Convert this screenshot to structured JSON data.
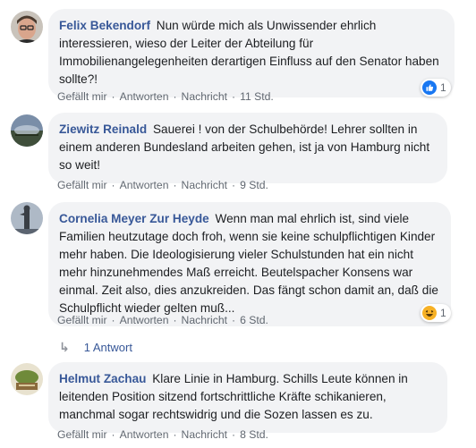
{
  "comments": [
    {
      "author": "Felix Bekendorf",
      "text": "Nun würde mich als Unwissender ehrlich interessieren, wieso der Leiter der Abteilung für Immobilienangelegenheiten derartigen Einfluss auf den Senator haben sollte?!",
      "actions": {
        "like": "Gefällt mir",
        "reply": "Antworten",
        "message": "Nachricht"
      },
      "time": "11 Std.",
      "reaction": {
        "icon": "like-icon",
        "count": "1"
      }
    },
    {
      "author": "Ziewitz Reinald",
      "text": "Sauerei ! von der Schulbehörde! Lehrer sollten in einem anderen Bundesland arbeiten gehen, ist ja von Hamburg nicht so weit!",
      "actions": {
        "like": "Gefällt mir",
        "reply": "Antworten",
        "message": "Nachricht"
      },
      "time": "9 Std."
    },
    {
      "author": "Cornelia Meyer Zur Heyde",
      "text": "Wenn man mal ehrlich ist, sind viele Familien heutzutage doch froh, wenn sie keine schulpflichtigen Kinder mehr haben. Die Ideologisierung vieler Schulstunden hat ein nicht mehr hinzunehmendes Maß erreicht. Beutelspacher Konsens war einmal. Zeit also, dies anzukreiden. Das fängt schon damit an, daß die Schulpflicht wieder gelten muß...",
      "actions": {
        "like": "Gefällt mir",
        "reply": "Antworten",
        "message": "Nachricht"
      },
      "time": "6 Std.",
      "reaction": {
        "icon": "haha-icon",
        "count": "1"
      },
      "replies": "1 Antwort"
    },
    {
      "author": "Helmut Zachau",
      "text": "Klare Linie in Hamburg. Schills Leute können in leitenden Position sitzend fortschrittliche Kräfte schikanieren, manchmal sogar rechtswidrig und die Sozen lassen es zu.",
      "actions": {
        "like": "Gefällt mir",
        "reply": "Antworten",
        "message": "Nachricht"
      },
      "time": "8 Std."
    }
  ],
  "colors": {
    "author": "#385898",
    "bubble": "#f2f3f5",
    "meta": "#606770",
    "like": "#1877f2",
    "haha": "#f7b125"
  }
}
